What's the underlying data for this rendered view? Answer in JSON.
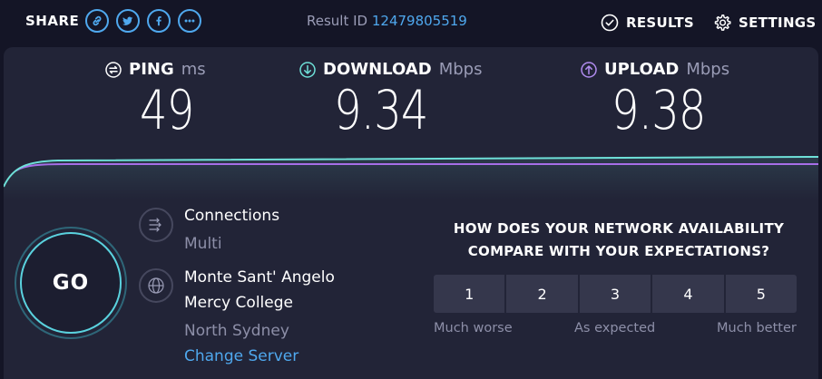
{
  "topbar": {
    "share_label": "SHARE",
    "share_icons": [
      "link-icon",
      "twitter-icon",
      "facebook-icon",
      "more-icon"
    ],
    "result_id_label": "Result ID",
    "result_id": "12479805519",
    "results_label": "RESULTS",
    "settings_label": "SETTINGS"
  },
  "metrics": {
    "ping": {
      "label": "PING",
      "unit": "ms",
      "value": "49",
      "color": "#ffffff"
    },
    "download": {
      "label": "DOWNLOAD",
      "unit": "Mbps",
      "value": "9.34",
      "color": "#6ee0d8"
    },
    "upload": {
      "label": "UPLOAD",
      "unit": "Mbps",
      "value": "9.38",
      "color": "#b18cf0"
    }
  },
  "go": {
    "label": "GO"
  },
  "connections": {
    "title": "Connections",
    "value": "Multi"
  },
  "server": {
    "name_line1": "Monte Sant' Angelo",
    "name_line2": "Mercy College",
    "location": "North Sydney",
    "change_label": "Change Server"
  },
  "survey": {
    "question": "HOW DOES YOUR NETWORK AVAILABILITY\nCOMPARE WITH YOUR EXPECTATIONS?",
    "options": [
      "1",
      "2",
      "3",
      "4",
      "5"
    ],
    "low_label": "Much worse",
    "mid_label": "As expected",
    "high_label": "Much better"
  },
  "colors": {
    "accent": "#4fa8ee",
    "download_line": "#6ee0d8",
    "upload_line": "#a66ee8"
  }
}
